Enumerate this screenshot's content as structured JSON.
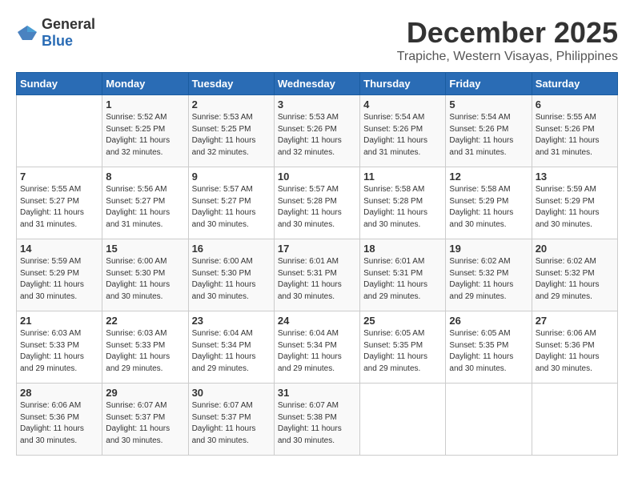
{
  "logo": {
    "general": "General",
    "blue": "Blue"
  },
  "title": "December 2025",
  "location": "Trapiche, Western Visayas, Philippines",
  "headers": [
    "Sunday",
    "Monday",
    "Tuesday",
    "Wednesday",
    "Thursday",
    "Friday",
    "Saturday"
  ],
  "weeks": [
    [
      {
        "day": "",
        "sunrise": "",
        "sunset": "",
        "daylight": ""
      },
      {
        "day": "1",
        "sunrise": "Sunrise: 5:52 AM",
        "sunset": "Sunset: 5:25 PM",
        "daylight": "Daylight: 11 hours and 32 minutes."
      },
      {
        "day": "2",
        "sunrise": "Sunrise: 5:53 AM",
        "sunset": "Sunset: 5:25 PM",
        "daylight": "Daylight: 11 hours and 32 minutes."
      },
      {
        "day": "3",
        "sunrise": "Sunrise: 5:53 AM",
        "sunset": "Sunset: 5:26 PM",
        "daylight": "Daylight: 11 hours and 32 minutes."
      },
      {
        "day": "4",
        "sunrise": "Sunrise: 5:54 AM",
        "sunset": "Sunset: 5:26 PM",
        "daylight": "Daylight: 11 hours and 31 minutes."
      },
      {
        "day": "5",
        "sunrise": "Sunrise: 5:54 AM",
        "sunset": "Sunset: 5:26 PM",
        "daylight": "Daylight: 11 hours and 31 minutes."
      },
      {
        "day": "6",
        "sunrise": "Sunrise: 5:55 AM",
        "sunset": "Sunset: 5:26 PM",
        "daylight": "Daylight: 11 hours and 31 minutes."
      }
    ],
    [
      {
        "day": "7",
        "sunrise": "Sunrise: 5:55 AM",
        "sunset": "Sunset: 5:27 PM",
        "daylight": "Daylight: 11 hours and 31 minutes."
      },
      {
        "day": "8",
        "sunrise": "Sunrise: 5:56 AM",
        "sunset": "Sunset: 5:27 PM",
        "daylight": "Daylight: 11 hours and 31 minutes."
      },
      {
        "day": "9",
        "sunrise": "Sunrise: 5:57 AM",
        "sunset": "Sunset: 5:27 PM",
        "daylight": "Daylight: 11 hours and 30 minutes."
      },
      {
        "day": "10",
        "sunrise": "Sunrise: 5:57 AM",
        "sunset": "Sunset: 5:28 PM",
        "daylight": "Daylight: 11 hours and 30 minutes."
      },
      {
        "day": "11",
        "sunrise": "Sunrise: 5:58 AM",
        "sunset": "Sunset: 5:28 PM",
        "daylight": "Daylight: 11 hours and 30 minutes."
      },
      {
        "day": "12",
        "sunrise": "Sunrise: 5:58 AM",
        "sunset": "Sunset: 5:29 PM",
        "daylight": "Daylight: 11 hours and 30 minutes."
      },
      {
        "day": "13",
        "sunrise": "Sunrise: 5:59 AM",
        "sunset": "Sunset: 5:29 PM",
        "daylight": "Daylight: 11 hours and 30 minutes."
      }
    ],
    [
      {
        "day": "14",
        "sunrise": "Sunrise: 5:59 AM",
        "sunset": "Sunset: 5:29 PM",
        "daylight": "Daylight: 11 hours and 30 minutes."
      },
      {
        "day": "15",
        "sunrise": "Sunrise: 6:00 AM",
        "sunset": "Sunset: 5:30 PM",
        "daylight": "Daylight: 11 hours and 30 minutes."
      },
      {
        "day": "16",
        "sunrise": "Sunrise: 6:00 AM",
        "sunset": "Sunset: 5:30 PM",
        "daylight": "Daylight: 11 hours and 30 minutes."
      },
      {
        "day": "17",
        "sunrise": "Sunrise: 6:01 AM",
        "sunset": "Sunset: 5:31 PM",
        "daylight": "Daylight: 11 hours and 30 minutes."
      },
      {
        "day": "18",
        "sunrise": "Sunrise: 6:01 AM",
        "sunset": "Sunset: 5:31 PM",
        "daylight": "Daylight: 11 hours and 29 minutes."
      },
      {
        "day": "19",
        "sunrise": "Sunrise: 6:02 AM",
        "sunset": "Sunset: 5:32 PM",
        "daylight": "Daylight: 11 hours and 29 minutes."
      },
      {
        "day": "20",
        "sunrise": "Sunrise: 6:02 AM",
        "sunset": "Sunset: 5:32 PM",
        "daylight": "Daylight: 11 hours and 29 minutes."
      }
    ],
    [
      {
        "day": "21",
        "sunrise": "Sunrise: 6:03 AM",
        "sunset": "Sunset: 5:33 PM",
        "daylight": "Daylight: 11 hours and 29 minutes."
      },
      {
        "day": "22",
        "sunrise": "Sunrise: 6:03 AM",
        "sunset": "Sunset: 5:33 PM",
        "daylight": "Daylight: 11 hours and 29 minutes."
      },
      {
        "day": "23",
        "sunrise": "Sunrise: 6:04 AM",
        "sunset": "Sunset: 5:34 PM",
        "daylight": "Daylight: 11 hours and 29 minutes."
      },
      {
        "day": "24",
        "sunrise": "Sunrise: 6:04 AM",
        "sunset": "Sunset: 5:34 PM",
        "daylight": "Daylight: 11 hours and 29 minutes."
      },
      {
        "day": "25",
        "sunrise": "Sunrise: 6:05 AM",
        "sunset": "Sunset: 5:35 PM",
        "daylight": "Daylight: 11 hours and 29 minutes."
      },
      {
        "day": "26",
        "sunrise": "Sunrise: 6:05 AM",
        "sunset": "Sunset: 5:35 PM",
        "daylight": "Daylight: 11 hours and 30 minutes."
      },
      {
        "day": "27",
        "sunrise": "Sunrise: 6:06 AM",
        "sunset": "Sunset: 5:36 PM",
        "daylight": "Daylight: 11 hours and 30 minutes."
      }
    ],
    [
      {
        "day": "28",
        "sunrise": "Sunrise: 6:06 AM",
        "sunset": "Sunset: 5:36 PM",
        "daylight": "Daylight: 11 hours and 30 minutes."
      },
      {
        "day": "29",
        "sunrise": "Sunrise: 6:07 AM",
        "sunset": "Sunset: 5:37 PM",
        "daylight": "Daylight: 11 hours and 30 minutes."
      },
      {
        "day": "30",
        "sunrise": "Sunrise: 6:07 AM",
        "sunset": "Sunset: 5:37 PM",
        "daylight": "Daylight: 11 hours and 30 minutes."
      },
      {
        "day": "31",
        "sunrise": "Sunrise: 6:07 AM",
        "sunset": "Sunset: 5:38 PM",
        "daylight": "Daylight: 11 hours and 30 minutes."
      },
      {
        "day": "",
        "sunrise": "",
        "sunset": "",
        "daylight": ""
      },
      {
        "day": "",
        "sunrise": "",
        "sunset": "",
        "daylight": ""
      },
      {
        "day": "",
        "sunrise": "",
        "sunset": "",
        "daylight": ""
      }
    ]
  ]
}
